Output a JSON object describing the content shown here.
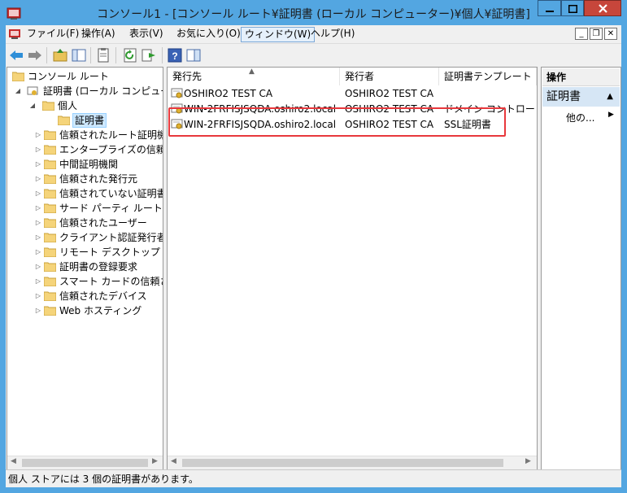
{
  "window": {
    "title": "コンソール1 - [コンソール ルート¥証明書 (ローカル コンピューター)¥個人¥証明書]"
  },
  "menu": [
    {
      "label": "ファイル(F)"
    },
    {
      "label": "操作(A)"
    },
    {
      "label": "表示(V)"
    },
    {
      "label": "お気に入り(O)"
    },
    {
      "label": "ウィンドウ(W)"
    },
    {
      "label": "ヘルプ(H)"
    }
  ],
  "tree": {
    "root": "コンソール ルート",
    "certs": "証明書 (ローカル コンピューター)",
    "personal": "個人",
    "personal_certs": "証明書",
    "items": [
      "信頼されたルート証明機関",
      "エンタープライズの信頼",
      "中間証明機関",
      "信頼された発行元",
      "信頼されていない証明書",
      "サード パーティ ルート証明機関",
      "信頼されたユーザー",
      "クライアント認証発行者",
      "リモート デスクトップ",
      "証明書の登録要求",
      "スマート カードの信頼されたルート",
      "信頼されたデバイス",
      "Web ホスティング"
    ]
  },
  "list": {
    "columns": [
      "発行先",
      "発行者",
      "証明書テンプレート"
    ],
    "rows": [
      {
        "issued_to": "OSHIRO2 TEST CA",
        "issued_by": "OSHIRO2 TEST CA",
        "template": ""
      },
      {
        "issued_to": "WIN-2FRFISJSQDA.oshiro2.local",
        "issued_by": "OSHIRO2 TEST CA",
        "template": "ドメイン コントローラー"
      },
      {
        "issued_to": "WIN-2FRFISJSQDA.oshiro2.local",
        "issued_by": "OSHIRO2 TEST CA",
        "template": "SSL証明書"
      }
    ]
  },
  "actions": {
    "header": "操作",
    "section": "証明書",
    "more": "他の..."
  },
  "status": {
    "text": "個人 ストアには 3 個の証明書があります。"
  },
  "colors": {
    "titlebar": "#53a6e1",
    "close": "#c7463b",
    "highlight": "#e8383c"
  }
}
